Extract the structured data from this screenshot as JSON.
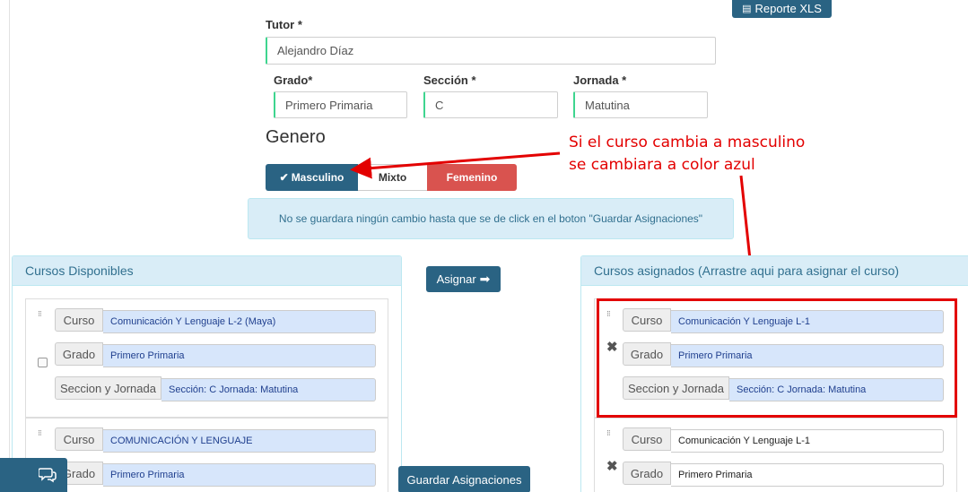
{
  "header": {
    "report_button": "Reporte XLS"
  },
  "form": {
    "tutor_label": "Tutor *",
    "tutor_value": "Alejandro Díaz",
    "grado_label": "Grado*",
    "grado_value": "Primero Primaria",
    "seccion_label": "Sección *",
    "seccion_value": "C",
    "jornada_label": "Jornada *",
    "jornada_value": "Matutina"
  },
  "genero": {
    "title": "Genero",
    "options": {
      "masculino": "Masculino",
      "mixto": "Mixto",
      "femenino": "Femenino"
    },
    "selected": "Masculino"
  },
  "annotation": {
    "line1": "Si el curso cambia a masculino",
    "line2": "se cambiara a color azul"
  },
  "alert": {
    "text": "No se guardara ningún cambio hasta que se de click en el boton \"Guardar Asignaciones\""
  },
  "available": {
    "title": "Cursos Disponibles",
    "cards": [
      {
        "curso_label": "Curso",
        "curso": "Comunicación Y Lenguaje L-2 (Maya)",
        "grado_label": "Grado",
        "grado": "Primero Primaria",
        "sj_label": "Seccion y Jornada",
        "sj": "Sección: C Jornada: Matutina"
      },
      {
        "curso_label": "Curso",
        "curso": "COMUNICACIÓN Y LENGUAJE",
        "grado_label": "Grado",
        "grado": "Primero Primaria"
      }
    ]
  },
  "assign_button": "Asignar",
  "save_button": "Guardar Asignaciones",
  "assigned": {
    "title": "Cursos asignados (Arrastre aqui para asignar el curso)",
    "cards": [
      {
        "curso_label": "Curso",
        "curso": "Comunicación Y Lenguaje L-1",
        "grado_label": "Grado",
        "grado": "Primero Primaria",
        "sj_label": "Seccion y Jornada",
        "sj": "Sección: C Jornada: Matutina"
      },
      {
        "curso_label": "Curso",
        "curso": "Comunicación Y Lenguaje L-1",
        "grado_label": "Grado",
        "grado": "Primero Primaria"
      }
    ]
  },
  "colors": {
    "primary": "#2a6383",
    "femenino": "#d9534f",
    "field_accent": "#3ed58f",
    "annotation": "#e30000",
    "highlight_value": "#d7e6fb"
  }
}
